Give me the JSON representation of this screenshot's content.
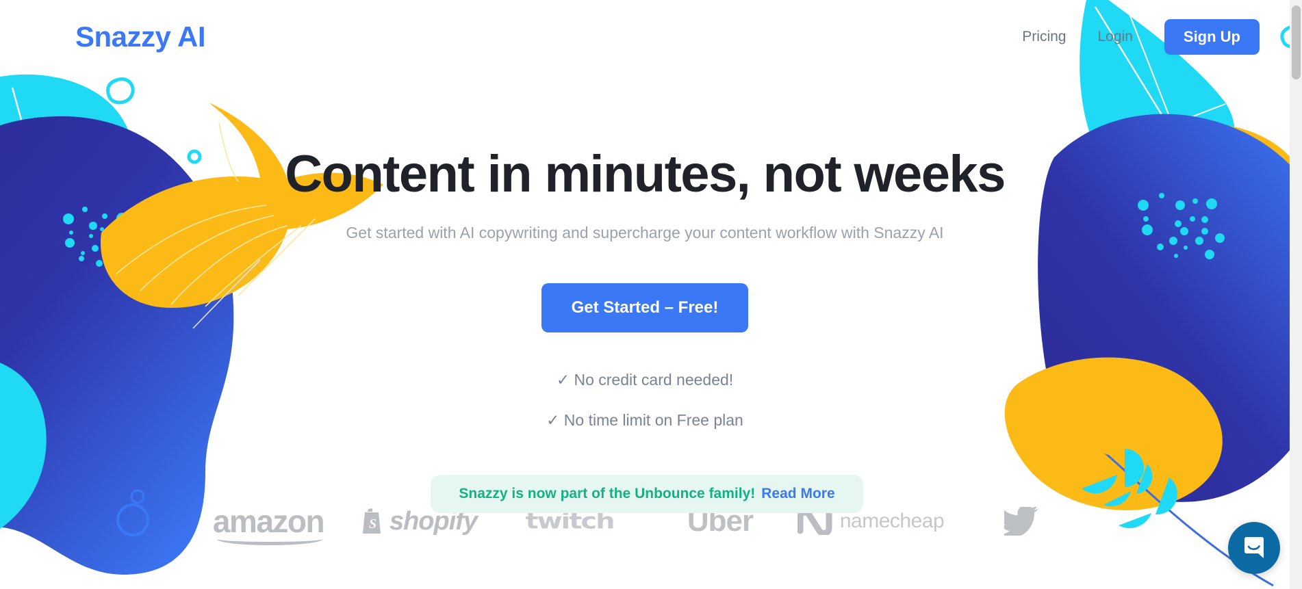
{
  "header": {
    "brand": "Snazzy AI",
    "nav_links": [
      {
        "label": "Pricing",
        "name": "pricing"
      },
      {
        "label": "Login",
        "name": "login"
      }
    ],
    "signup_label": "Sign Up"
  },
  "hero": {
    "headline": "Content in minutes, not weeks",
    "subhead": "Get started with AI copywriting and supercharge your content workflow with Snazzy AI",
    "cta_label": "Get Started – Free!",
    "perks": [
      "✓ No credit card needed!",
      "✓ No time limit on Free plan"
    ]
  },
  "banner": {
    "text": "Snazzy is now part of the Unbounce family!",
    "link_label": "Read More"
  },
  "logos": [
    {
      "name": "amazon",
      "label": "amazon"
    },
    {
      "name": "shopify",
      "label": "shopify"
    },
    {
      "name": "twitch",
      "label": "twitch"
    },
    {
      "name": "uber",
      "label": "Uber"
    },
    {
      "name": "namecheap",
      "label": "namecheap"
    },
    {
      "name": "twitter",
      "label": ""
    }
  ],
  "colors": {
    "brand_blue": "#3b78f6",
    "deep_indigo": "#2a2a8f",
    "cyan": "#1fd9f5",
    "yellow": "#fbba16",
    "banner_green": "#13b183",
    "banner_bg": "#e6f7f1",
    "text_dark": "#1f2228",
    "text_muted": "#7a8393",
    "intercom_blue": "#0b69a3"
  },
  "widgets": {
    "intercom_label": "Open chat"
  },
  "scrollbar": {
    "position": "top"
  }
}
